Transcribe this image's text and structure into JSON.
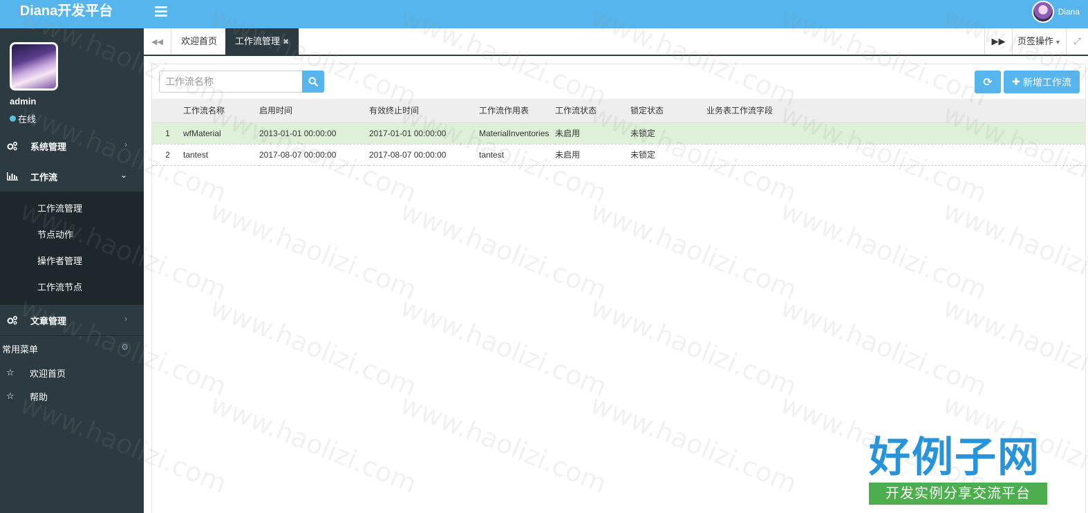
{
  "header": {
    "brand": "Diana开发平台",
    "user_name": "Diana"
  },
  "sidebar": {
    "user": {
      "name": "admin",
      "status": "在线"
    },
    "menu": [
      {
        "label": "系统管理",
        "icon": "gears-icon",
        "expanded": false
      },
      {
        "label": "工作流",
        "icon": "bar-chart-icon",
        "expanded": true,
        "children": [
          "工作流管理",
          "节点动作",
          "操作者管理",
          "工作流节点"
        ]
      },
      {
        "label": "文章管理",
        "icon": "gears-icon",
        "expanded": false
      }
    ],
    "favorites": {
      "title": "常用菜单",
      "items": [
        "欢迎首页",
        "帮助"
      ]
    }
  },
  "tabs": {
    "items": [
      {
        "label": "欢迎首页",
        "active": false
      },
      {
        "label": "工作流管理",
        "active": true
      }
    ],
    "page_ops": "页签操作"
  },
  "toolbar": {
    "search_placeholder": "工作流名称",
    "add_label": "新增工作流"
  },
  "table": {
    "columns": [
      "",
      "工作流名称",
      "启用时间",
      "有效终止时间",
      "工作流作用表",
      "工作流状态",
      "锁定状态",
      "业务表工作流字段"
    ],
    "rows": [
      [
        "1",
        "wfMaterial",
        "2013-01-01 00:00:00",
        "2017-01-01 00:00:00",
        "MaterialInventories",
        "未启用",
        "未锁定",
        ""
      ],
      [
        "2",
        "tantest",
        "2017-08-07 00:00:00",
        "2017-08-07 00:00:00",
        "tantest",
        "未启用",
        "未锁定",
        ""
      ]
    ],
    "selected_row": 0
  },
  "watermark": {
    "text": "www.haolizi.com",
    "logo_big": "好例子网",
    "logo_small": "开发实例分享交流平台"
  },
  "colors": {
    "primary": "#55b5ec",
    "sidebar": "#2c3b41",
    "selected_row": "#dff0d8"
  }
}
